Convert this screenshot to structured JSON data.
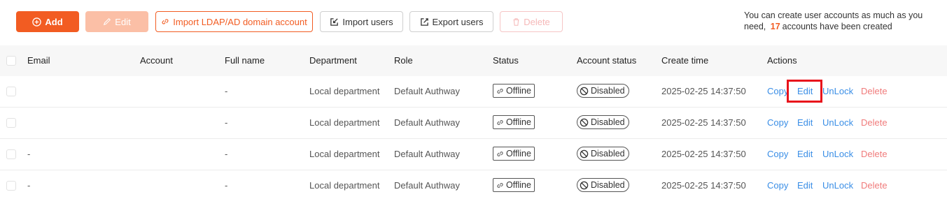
{
  "toolbar": {
    "add_label": "Add",
    "edit_label": "Edit",
    "ldap_label": "Import LDAP/AD domain account",
    "import_label": "Import users",
    "export_label": "Export users",
    "delete_label": "Delete"
  },
  "quota": {
    "prefix": "You can create user accounts as much as you need,",
    "count": "17",
    "suffix": "accounts have been created"
  },
  "table": {
    "headers": {
      "email": "Email",
      "account": "Account",
      "full_name": "Full name",
      "department": "Department",
      "role": "Role",
      "status": "Status",
      "account_status": "Account status",
      "create_time": "Create time",
      "actions": "Actions"
    },
    "rows": [
      {
        "email": "",
        "account": "",
        "full_name": "-",
        "department": "Local department",
        "role": "Default Authway",
        "status": "Offline",
        "account_status": "Disabled",
        "create_time": "2025-02-25 14:37:50"
      },
      {
        "email": "",
        "account": "",
        "full_name": "-",
        "department": "Local department",
        "role": "Default Authway",
        "status": "Offline",
        "account_status": "Disabled",
        "create_time": "2025-02-25 14:37:50"
      },
      {
        "email": "-",
        "account": "",
        "full_name": "-",
        "department": "Local department",
        "role": "Default Authway",
        "status": "Offline",
        "account_status": "Disabled",
        "create_time": "2025-02-25 14:37:50"
      },
      {
        "email": "-",
        "account": "",
        "full_name": "-",
        "department": "Local department",
        "role": "Default Authway",
        "status": "Offline",
        "account_status": "Disabled",
        "create_time": "2025-02-25 14:37:50"
      }
    ],
    "actions": {
      "copy": "Copy",
      "edit": "Edit",
      "unlock": "UnLock",
      "delete": "Delete"
    }
  },
  "icons": {
    "add": "plus-circle-icon",
    "edit": "pencil-icon",
    "ldap": "link-icon",
    "import": "import-icon",
    "export": "export-icon",
    "delete": "trash-icon",
    "offline": "link-icon",
    "disabled": "ban-icon"
  },
  "colors": {
    "accent": "#f25c22",
    "link": "#3a8ee6",
    "danger": "#f07b7b",
    "highlight": "#e8131b"
  }
}
